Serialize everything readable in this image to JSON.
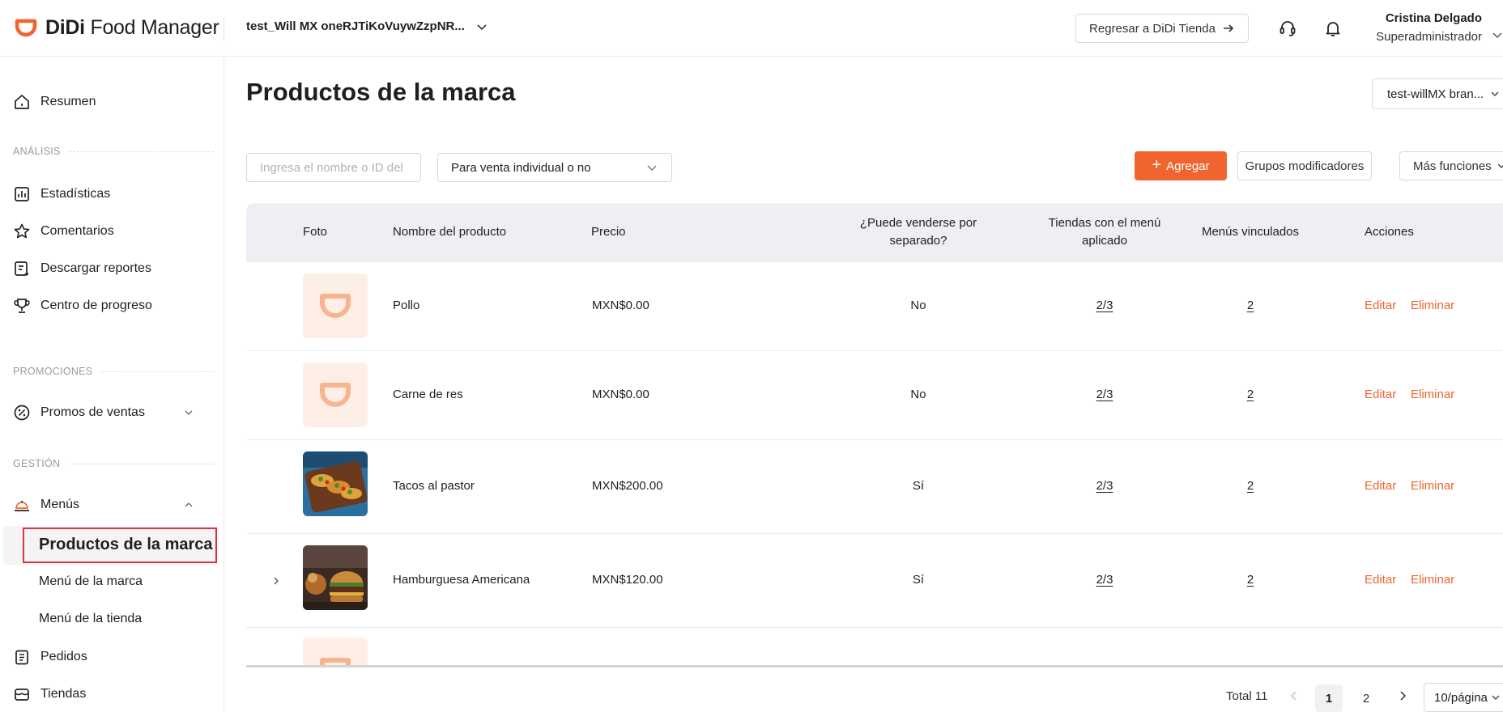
{
  "header": {
    "logo_brand": "DiDi",
    "logo_product": "Food Manager",
    "store_name": "test_Will MX oneRJTiKoVuywZzpNR...",
    "back_button": "Regresar a DiDi Tienda",
    "user_name": "Cristina Delgado",
    "user_role": "Superadministrador"
  },
  "sidebar": {
    "resumen": "Resumen",
    "section_analisis": "ANÁLISIS",
    "estadisticas": "Estadísticas",
    "comentarios": "Comentarios",
    "descargar": "Descargar reportes",
    "progreso": "Centro de progreso",
    "section_promociones": "PROMOCIONES",
    "promos": "Promos de ventas",
    "section_gestion": "GESTIÓN",
    "menus": "Menús",
    "productos": "Productos de la marca",
    "menu_marca": "Menú de la marca",
    "menu_tienda": "Menú de la tienda",
    "pedidos": "Pedidos",
    "tiendas": "Tiendas"
  },
  "main": {
    "title": "Productos de la marca",
    "brand_select": "test-willMX bran...",
    "search_placeholder": "Ingresa el nombre o ID del",
    "filter_value": "Para venta individual o no",
    "add_button": "Agregar",
    "groups_button": "Grupos modificadores",
    "more_button": "Más funciones"
  },
  "table": {
    "headers": {
      "foto": "Foto",
      "nombre": "Nombre del producto",
      "precio": "Precio",
      "separado_1": "¿Puede venderse por",
      "separado_2": "separado?",
      "tiendas_1": "Tiendas con el menú",
      "tiendas_2": "aplicado",
      "menus": "Menús vinculados",
      "acciones": "Acciones"
    },
    "edit_label": "Editar",
    "delete_label": "Eliminar",
    "rows": [
      {
        "name": "Pollo",
        "price": "MXN$0.00",
        "separate": "No",
        "stores": "2/3",
        "menus": "2"
      },
      {
        "name": "Carne de res",
        "price": "MXN$0.00",
        "separate": "No",
        "stores": "2/3",
        "menus": "2"
      },
      {
        "name": "Tacos al pastor",
        "price": "MXN$200.00",
        "separate": "Sí",
        "stores": "2/3",
        "menus": "2"
      },
      {
        "name": "Hamburguesa Americana",
        "price": "MXN$120.00",
        "separate": "Sí",
        "stores": "2/3",
        "menus": "2"
      }
    ]
  },
  "pagination": {
    "total": "Total 11",
    "page_1": "1",
    "page_2": "2",
    "page_size": "10/página"
  },
  "colors": {
    "accent": "#f0642f",
    "placeholder_bg": "#fdefe6",
    "header_bg": "#eeeff3"
  }
}
